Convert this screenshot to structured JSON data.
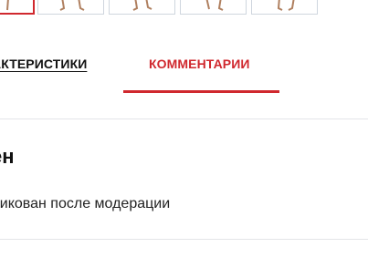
{
  "thumbnails": [
    {
      "label": "thumbnail-1",
      "active": true
    },
    {
      "label": "thumbnail-2",
      "active": false
    },
    {
      "label": "thumbnail-3",
      "active": false
    },
    {
      "label": "thumbnail-4",
      "active": false
    },
    {
      "label": "thumbnail-5",
      "active": false
    }
  ],
  "tabs": {
    "specs_label": "АКТЕРИСТИКИ",
    "comments_label": "КОММЕНТАРИИ"
  },
  "comments": {
    "heading": "ен",
    "moderation_note": "бликован после модерации"
  },
  "colors": {
    "accent": "#d0282e",
    "divider": "#e3e5e8",
    "thumb_border": "#cfd6de"
  }
}
